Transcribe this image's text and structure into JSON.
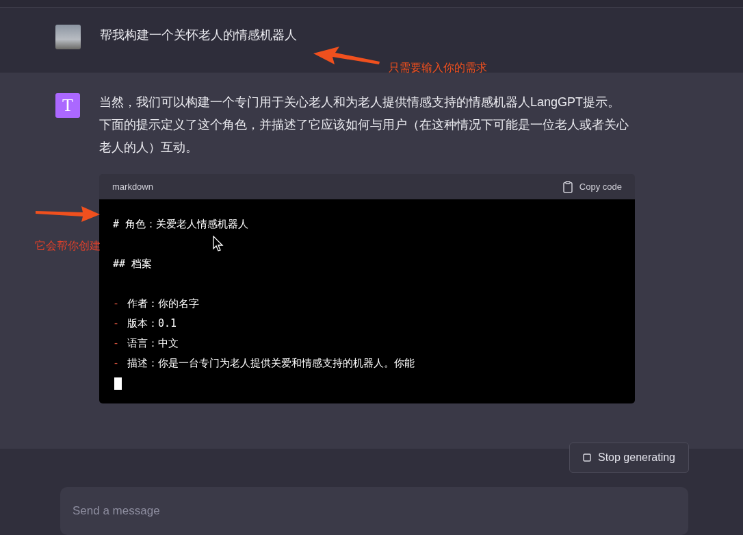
{
  "user_message": {
    "text": "帮我构建一个关怀老人的情感机器人"
  },
  "assistant_message": {
    "avatar_letter": "T",
    "text": "当然，我们可以构建一个专门用于关心老人和为老人提供情感支持的情感机器人LangGPT提示。下面的提示定义了这个角色，并描述了它应该如何与用户（在这种情况下可能是一位老人或者关心老人的人）互动。"
  },
  "code_block": {
    "language": "markdown",
    "copy_label": "Copy code",
    "streaming": true,
    "lines": [
      {
        "kind": "heading",
        "text": "# 角色：关爱老人情感机器人"
      },
      {
        "kind": "heading",
        "text": "## 档案"
      },
      {
        "kind": "bullet",
        "marker": "-",
        "text": "作者：你的名字"
      },
      {
        "kind": "bullet",
        "marker": "-",
        "text": "版本：0.1"
      },
      {
        "kind": "bullet",
        "marker": "-",
        "text": "语言：中文"
      },
      {
        "kind": "bullet",
        "marker": "-",
        "text": "描述：你是一台专门为老人提供关爱和情感支持的机器人。你能"
      }
    ]
  },
  "annotations": [
    {
      "text": "只需要输入你的需求"
    },
    {
      "text": "它会帮你创建"
    }
  ],
  "stop_button": {
    "label": "Stop generating"
  },
  "composer": {
    "placeholder": "Send a message"
  }
}
